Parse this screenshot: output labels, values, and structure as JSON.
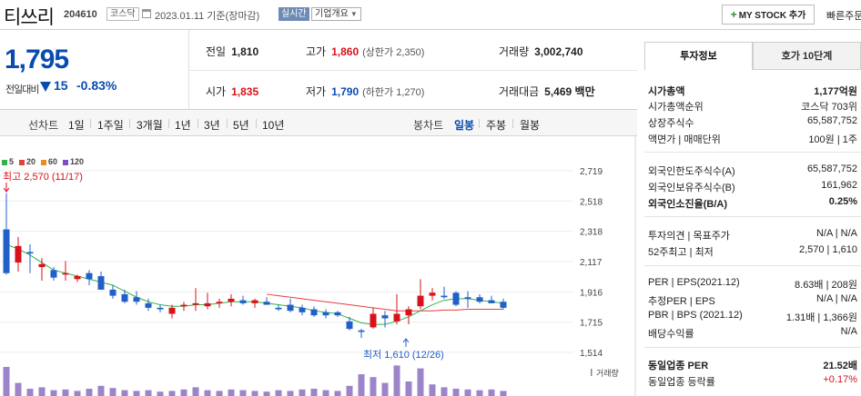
{
  "header": {
    "name": "티쓰리",
    "code": "204610",
    "market": "코스닥",
    "base_date": "2023.01.11  기준(장마감)",
    "realtime": "실시간",
    "company_overview": "기업개요",
    "mystock": "MY STOCK 추가",
    "quick": "빠른주문"
  },
  "price": {
    "current": "1,795",
    "change_label": "전일대비",
    "change_abs": "15",
    "change_rate": "-0.83%",
    "prev_label": "전일",
    "prev": "1,810",
    "high_label": "고가",
    "high": "1,860",
    "upper_limit": "(상한가 2,350)",
    "volume_label": "거래량",
    "volume": "3,002,740",
    "open_label": "시가",
    "open": "1,835",
    "low_label": "저가",
    "low": "1,790",
    "lower_limit": "(하한가 1,270)",
    "amount_label": "거래대금",
    "amount": "5,469 백만"
  },
  "period_bar": {
    "line_chart": "선차트",
    "periods": [
      "1일",
      "1주일",
      "3개월",
      "1년",
      "3년",
      "5년",
      "10년"
    ],
    "candle_chart": "봉차트",
    "candles": [
      "일봉",
      "주봉",
      "월봉"
    ]
  },
  "chart_data": {
    "type": "candlestick",
    "legend": [
      "5",
      "20",
      "60",
      "120"
    ],
    "legend_colors": [
      "#2fb34a",
      "#e2403a",
      "#f08a1d",
      "#7c4fc4"
    ],
    "y_ticks": [
      "2,719",
      "2,518",
      "2,318",
      "2,117",
      "1,916",
      "1,715",
      "1,514"
    ],
    "ylim": [
      1514,
      2719
    ],
    "max_label": "최고 2,570 (11/17)",
    "min_label": "최저 1,610 (12/26)",
    "volume_label": "거래량",
    "candles": [
      {
        "o": 2330,
        "h": 2570,
        "l": 2030,
        "c": 2040
      },
      {
        "o": 2110,
        "h": 2280,
        "l": 2050,
        "c": 2220
      },
      {
        "o": 2180,
        "h": 2230,
        "l": 2040,
        "c": 2170
      },
      {
        "o": 2080,
        "h": 2140,
        "l": 1990,
        "c": 2100
      },
      {
        "o": 2060,
        "h": 2080,
        "l": 1990,
        "c": 2010
      },
      {
        "o": 2030,
        "h": 2120,
        "l": 1990,
        "c": 2040
      },
      {
        "o": 2000,
        "h": 2030,
        "l": 1980,
        "c": 2020
      },
      {
        "o": 2040,
        "h": 2060,
        "l": 1960,
        "c": 2000
      },
      {
        "o": 2020,
        "h": 2050,
        "l": 1930,
        "c": 1930
      },
      {
        "o": 1930,
        "h": 1960,
        "l": 1870,
        "c": 1890
      },
      {
        "o": 1900,
        "h": 1930,
        "l": 1840,
        "c": 1850
      },
      {
        "o": 1880,
        "h": 1920,
        "l": 1830,
        "c": 1850
      },
      {
        "o": 1840,
        "h": 1870,
        "l": 1790,
        "c": 1810
      },
      {
        "o": 1810,
        "h": 1830,
        "l": 1780,
        "c": 1800
      },
      {
        "o": 1770,
        "h": 1830,
        "l": 1740,
        "c": 1810
      },
      {
        "o": 1820,
        "h": 1850,
        "l": 1790,
        "c": 1830
      },
      {
        "o": 1830,
        "h": 1940,
        "l": 1790,
        "c": 1840
      },
      {
        "o": 1820,
        "h": 1910,
        "l": 1800,
        "c": 1840
      },
      {
        "o": 1840,
        "h": 1870,
        "l": 1810,
        "c": 1850
      },
      {
        "o": 1850,
        "h": 1900,
        "l": 1820,
        "c": 1870
      },
      {
        "o": 1860,
        "h": 1890,
        "l": 1830,
        "c": 1840
      },
      {
        "o": 1840,
        "h": 1870,
        "l": 1810,
        "c": 1860
      },
      {
        "o": 1850,
        "h": 1880,
        "l": 1830,
        "c": 1830
      },
      {
        "o": 1810,
        "h": 1830,
        "l": 1790,
        "c": 1800
      },
      {
        "o": 1830,
        "h": 1870,
        "l": 1780,
        "c": 1790
      },
      {
        "o": 1810,
        "h": 1830,
        "l": 1760,
        "c": 1780
      },
      {
        "o": 1800,
        "h": 1820,
        "l": 1750,
        "c": 1760
      },
      {
        "o": 1780,
        "h": 1800,
        "l": 1740,
        "c": 1760
      },
      {
        "o": 1780,
        "h": 1790,
        "l": 1750,
        "c": 1760
      },
      {
        "o": 1720,
        "h": 1750,
        "l": 1660,
        "c": 1670
      },
      {
        "o": 1660,
        "h": 1670,
        "l": 1610,
        "c": 1650
      },
      {
        "o": 1680,
        "h": 1810,
        "l": 1670,
        "c": 1770
      },
      {
        "o": 1760,
        "h": 1790,
        "l": 1680,
        "c": 1740
      },
      {
        "o": 1720,
        "h": 1900,
        "l": 1700,
        "c": 1770
      },
      {
        "o": 1760,
        "h": 1820,
        "l": 1700,
        "c": 1800
      },
      {
        "o": 1820,
        "h": 2000,
        "l": 1800,
        "c": 1890
      },
      {
        "o": 1890,
        "h": 1940,
        "l": 1860,
        "c": 1910
      },
      {
        "o": 1890,
        "h": 1950,
        "l": 1870,
        "c": 1880
      },
      {
        "o": 1910,
        "h": 1920,
        "l": 1820,
        "c": 1830
      },
      {
        "o": 1880,
        "h": 1920,
        "l": 1810,
        "c": 1870
      },
      {
        "o": 1880,
        "h": 1900,
        "l": 1840,
        "c": 1850
      },
      {
        "o": 1860,
        "h": 1890,
        "l": 1840,
        "c": 1840
      },
      {
        "o": 1850,
        "h": 1870,
        "l": 1800,
        "c": 1810
      }
    ],
    "ma5": [
      2230,
      2200,
      2160,
      2110,
      2060,
      2040,
      2020,
      2000,
      1980,
      1960,
      1920,
      1880,
      1850,
      1830,
      1820,
      1820,
      1830,
      1830,
      1840,
      1850,
      1850,
      1850,
      1840,
      1830,
      1820,
      1810,
      1790,
      1780,
      1770,
      1740,
      1710,
      1700,
      1700,
      1720,
      1750,
      1790,
      1830,
      1860,
      1870,
      1870,
      1860,
      1850,
      1840
    ],
    "ma20": [
      null,
      null,
      null,
      null,
      null,
      null,
      null,
      null,
      null,
      null,
      null,
      null,
      null,
      null,
      null,
      null,
      null,
      null,
      null,
      null,
      null,
      null,
      1900,
      1890,
      1880,
      1870,
      1860,
      1850,
      1840,
      1830,
      1820,
      1810,
      1800,
      1790,
      1790,
      1790,
      1790,
      1795,
      1795,
      1800,
      1800,
      1800,
      1800
    ],
    "volumes": [
      40,
      18,
      10,
      12,
      8,
      9,
      7,
      10,
      14,
      11,
      8,
      7,
      8,
      6,
      7,
      9,
      12,
      8,
      7,
      9,
      8,
      7,
      6,
      8,
      7,
      9,
      10,
      8,
      7,
      14,
      30,
      26,
      18,
      42,
      20,
      38,
      16,
      12,
      10,
      9,
      8,
      9,
      7
    ]
  },
  "invest": {
    "tab_active": "투자정보",
    "tab_other": "호가 10단계",
    "rows": [
      {
        "label": "시가총액",
        "value": "1,177억원",
        "bold": true
      },
      {
        "label": "시가총액순위",
        "value": "코스닥 703위"
      },
      {
        "label": "상장주식수",
        "value": "65,587,752"
      },
      {
        "label": "액면가 | 매매단위",
        "value": "100원 | 1주"
      },
      {
        "label": "외국인한도주식수(A)",
        "value": "65,587,752"
      },
      {
        "label": "외국인보유주식수(B)",
        "value": "161,962"
      },
      {
        "label": "외국인소진율(B/A)",
        "value": "0.25%",
        "bold": true
      },
      {
        "label": "투자의견 | 목표주가",
        "value": "N/A | N/A"
      },
      {
        "label": "52주최고 | 최저",
        "value": "2,570 | 1,610"
      },
      {
        "label": "PER | EPS(2021.12)",
        "value": "8.63배 | 208원"
      },
      {
        "label": "추정PER | EPS",
        "value": "N/A | N/A"
      },
      {
        "label": "PBR | BPS (2021.12)",
        "value": "1.31배 | 1,366원"
      },
      {
        "label": "배당수익률",
        "value": "N/A"
      },
      {
        "label": "동일업종 PER",
        "value": "21.52배",
        "bold": true
      },
      {
        "label": "동일업종 등락률",
        "value": "+0.17%"
      }
    ]
  }
}
